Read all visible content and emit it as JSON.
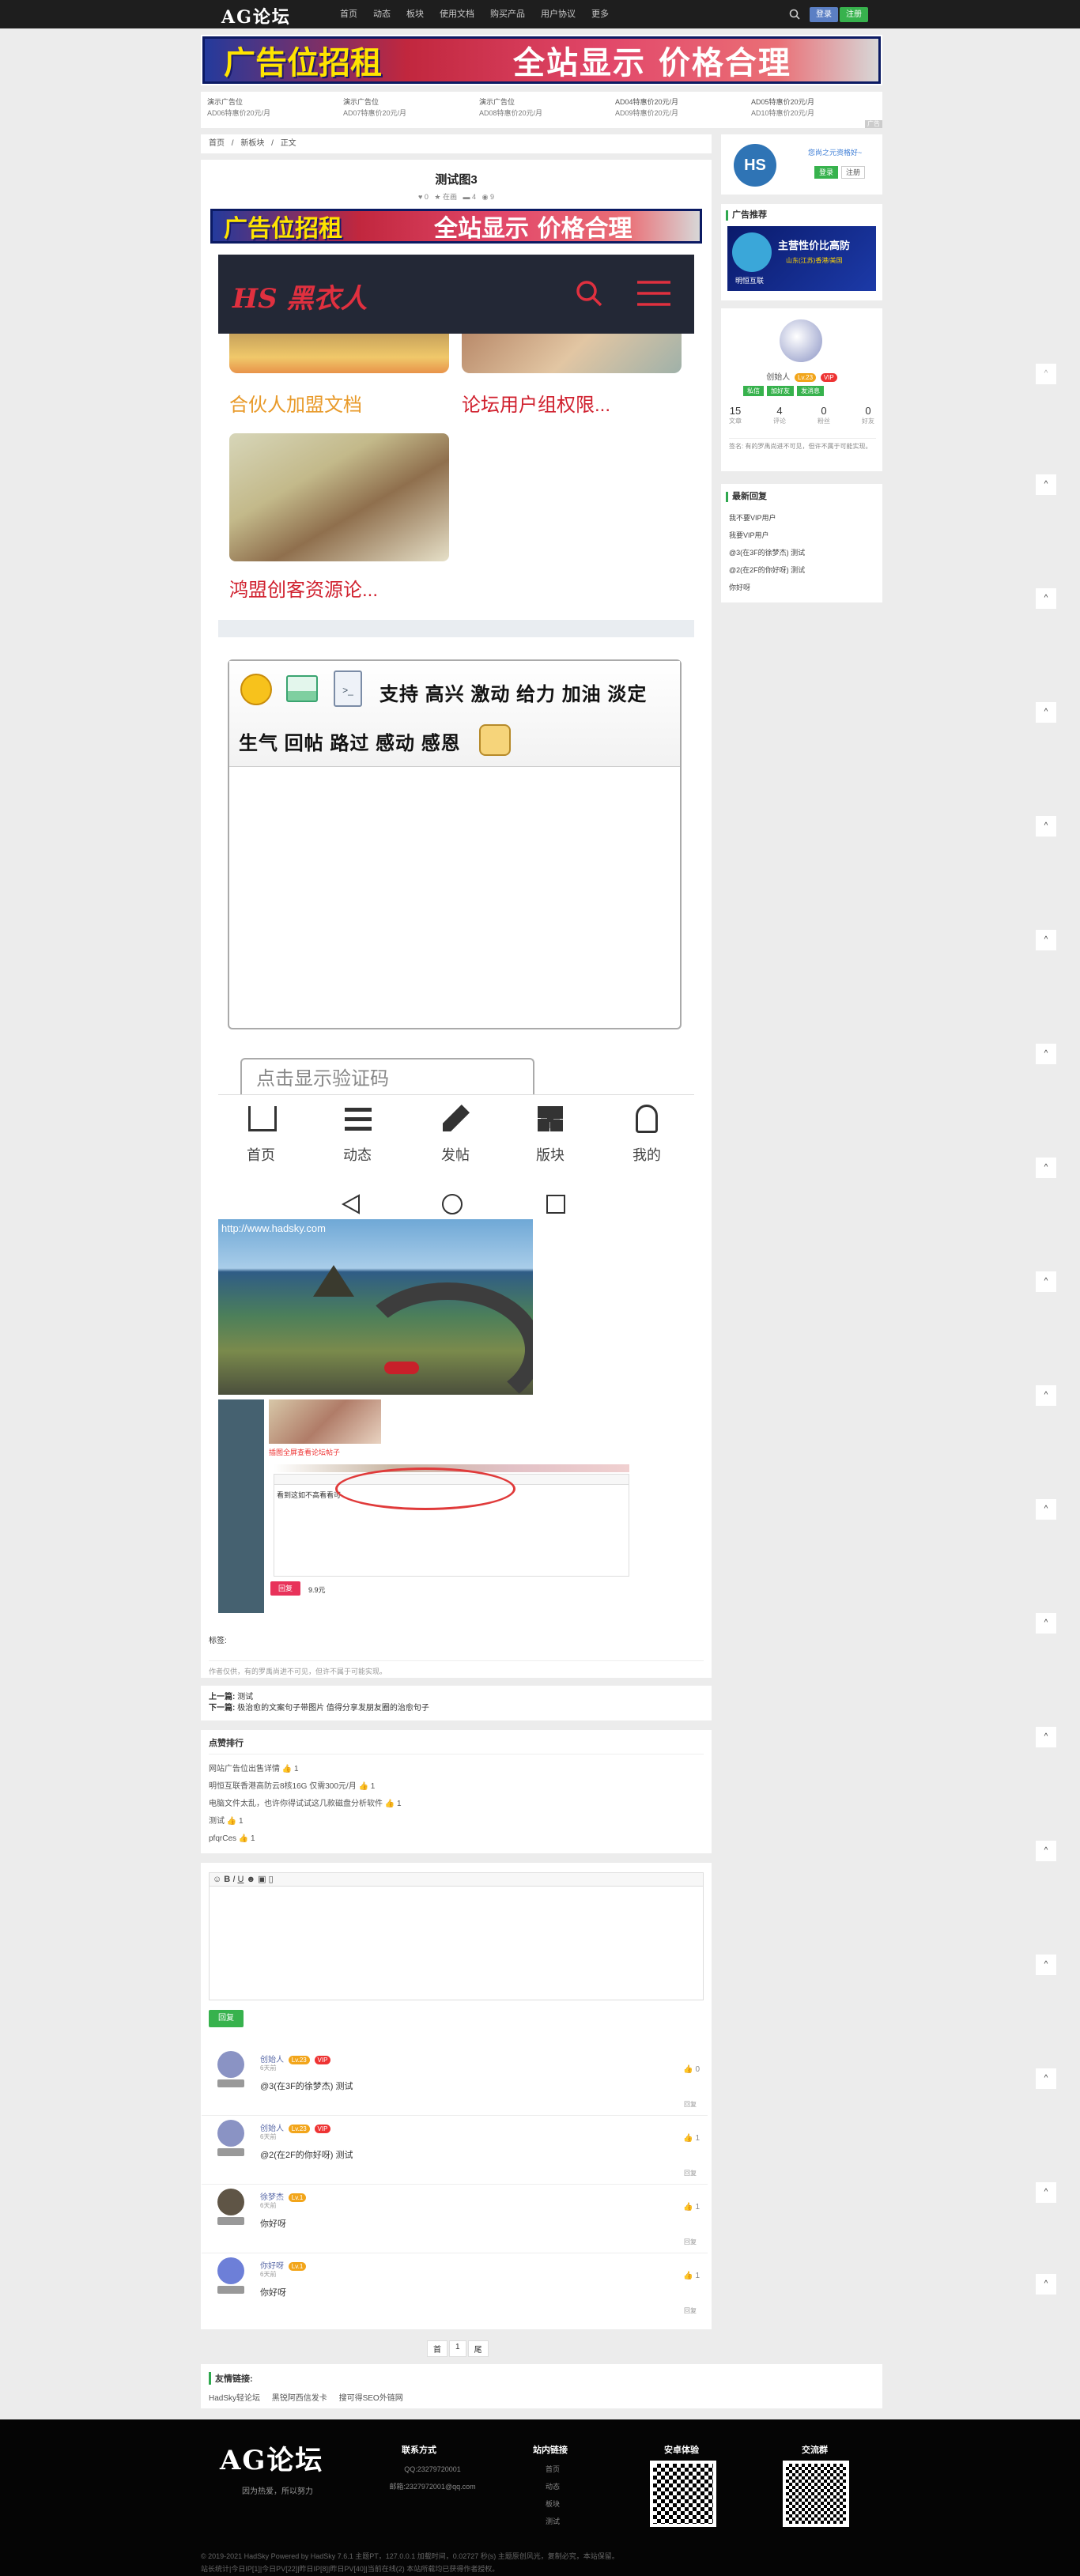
{
  "topbar": {
    "logo": "AG论坛",
    "nav": [
      "首页",
      "动态",
      "板块",
      "使用文档",
      "购买产品",
      "用户协议",
      "更多"
    ],
    "more_arrow": "▾",
    "login": "登录",
    "register": "注册"
  },
  "ad": {
    "banner_left": "广告位招租",
    "banner_right": "全站显示 价格合理",
    "grid": [
      {
        "title": "演示广告位",
        "sub": "AD06特惠价20元/月"
      },
      {
        "title": "演示广告位",
        "sub": "AD07特惠价20元/月"
      },
      {
        "title": "演示广告位",
        "sub": "AD08特惠价20元/月"
      },
      {
        "title": "AD04特惠价20元/月",
        "sub": "AD09特惠价20元/月"
      },
      {
        "title": "AD05特惠价20元/月",
        "sub": "AD10特惠价20元/月"
      }
    ],
    "corner": "广告"
  },
  "breadcrumb": {
    "home": "首页",
    "sep": "/",
    "board": "新板块",
    "cur": "正文"
  },
  "post": {
    "title": "测试图3",
    "stats": [
      "0",
      "在画",
      "4",
      "9"
    ],
    "phone_logo": "HS 黑衣人",
    "grid_items": [
      "合伙人加盟文档",
      "论坛用户组权限...",
      "鸿盟创客资源论..."
    ],
    "emoji_row1": [
      "支持",
      "高兴",
      "激动",
      "给力",
      "加油",
      "淡定"
    ],
    "emoji_row2": [
      "生气",
      "回帖",
      "路过",
      "感动",
      "感恩"
    ],
    "captcha": "点击显示验证码",
    "tabbar": [
      "首页",
      "动态",
      "发帖",
      "版块",
      "我的"
    ],
    "watermark": "http://www.hadsky.com",
    "shot_pink": "插图全屏查看论坛帖子",
    "shot_reply_text": "看到这如不高看看可",
    "shot_btn": "回复",
    "shot_price": "9.9元",
    "tags_label": "标签:",
    "notice": "作者仅供，有的罗禹尚进不可见，但许不属于可能实现。"
  },
  "prevnext": {
    "prev_label": "上一篇:",
    "prev": "测试",
    "next_label": "下一篇:",
    "next": "极治愈的文案句子带图片 值得分享发朋友圈的治愈句子"
  },
  "hot": {
    "title": "点赞排行",
    "items": [
      {
        "t": "网站广告位出售详情",
        "n": "1"
      },
      {
        "t": "明恒互联香港高防云8核16G 仅需300元/月",
        "n": "1"
      },
      {
        "t": "电脑文件太乱，也许你得试试这几款磁盘分析软件",
        "n": "1"
      },
      {
        "t": "测试",
        "n": "1"
      },
      {
        "t": "pfqrCes",
        "n": "1"
      }
    ]
  },
  "editor": {
    "submit": "回复"
  },
  "replies": [
    {
      "name": "创始人",
      "lv": "Lv.23",
      "vip": "VIP",
      "time": "6天前",
      "text": "@3(在3F的徐梦杰) 测试",
      "likes": "0",
      "tag": "回复",
      "avatar": "#8a93c4"
    },
    {
      "name": "创始人",
      "lv": "Lv.23",
      "vip": "VIP",
      "time": "6天前",
      "text": "@2(在2F的你好呀) 测试",
      "likes": "1",
      "tag": "回复",
      "avatar": "#8a93c4"
    },
    {
      "name": "徐梦杰",
      "lv": "Lv.1",
      "vip": "",
      "time": "6天前",
      "text": "你好呀",
      "likes": "1",
      "tag": "回复",
      "avatar": "#5f5546"
    },
    {
      "name": "你好呀",
      "lv": "Lv.1",
      "vip": "",
      "time": "6天前",
      "text": "你好呀",
      "likes": "1",
      "tag": "回复",
      "avatar": "#6d7fd8"
    }
  ],
  "pager": {
    "first": "首",
    "cur": "1",
    "last": "尾"
  },
  "links": {
    "title": "友情链接:",
    "items": [
      "HadSky轻论坛",
      "黑锐阿西信发卡",
      "搜可得SEO外链网"
    ]
  },
  "sidebar": {
    "visitor": "您尚之元资格好~",
    "login": "登录",
    "register": "注册",
    "ad_title": "广告推荐",
    "ad_text": "主营性价比高防",
    "ad_text2": "山东(江苏)香港/美国",
    "ad_brand": "明恒互联",
    "user_name": "创始人",
    "user_lv": "Lv.23",
    "user_vip": "VIP",
    "buttons": [
      "私信",
      "加好友",
      "发消息"
    ],
    "stats": [
      {
        "v": "15",
        "l": "文章"
      },
      {
        "v": "4",
        "l": "评论"
      },
      {
        "v": "0",
        "l": "粉丝"
      },
      {
        "v": "0",
        "l": "好友"
      }
    ],
    "sign": "签名: 有的罗禹尚进不可见，但许不属于可能实现。",
    "recent_title": "最新回复",
    "recent": [
      "我不要VIP用户",
      "我要VIP用户",
      "@3(在3F的徐梦杰) 测试",
      "@2(在2F的你好呀) 测试",
      "你好呀"
    ]
  },
  "footer": {
    "logo": "AG论坛",
    "slogan": "因为热爱，所以努力",
    "col1_title": "联系方式",
    "col1": [
      "QQ:23279720001",
      "邮箱:2327972001@qq.com"
    ],
    "col2_title": "站内链接",
    "col2": [
      "首页",
      "动态",
      "板块",
      "测试"
    ],
    "col3_title": "安卓体验",
    "col4_title": "交流群",
    "copy": "© 2019-2021 HadSky Powered by HadSky 7.6.1 主题PT，127.0.0.1 加载时间，0.02727 秒(s) 主题原创风光，复制必究，本站保留。",
    "copy2": "站长统计|今日IP[1]|今日PV[22]|昨日IP[8]|昨日PV[40]|当前在线(2) 本站所载均已获得作者授权。"
  }
}
